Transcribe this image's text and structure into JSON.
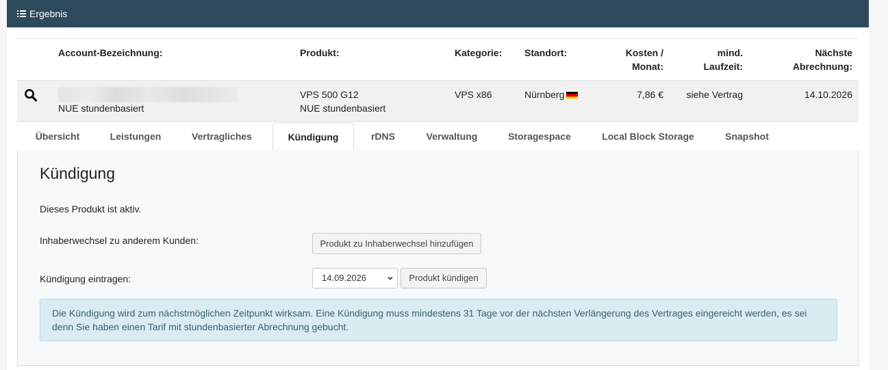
{
  "panel": {
    "title": "Ergebnis",
    "title_icon": "list-icon"
  },
  "table": {
    "headers": {
      "account": "Account-Bezeichnung:",
      "product": "Produkt:",
      "category": "Kategorie:",
      "location": "Standort:",
      "cost_line1": "Kosten /",
      "cost_line2": "Monat:",
      "term_line1": "mind.",
      "term_line2": "Laufzeit:",
      "billing_line1": "Nächste",
      "billing_line2": "Abrechnung:"
    },
    "row": {
      "account_sub": "NUE stundenbasiert",
      "product_line1": "VPS 500 G12",
      "product_line2": "NUE stundenbasiert",
      "category": "VPS x86",
      "location": "Nürnberg",
      "flag_colors": [
        "#000000",
        "#dd0000",
        "#ffce00"
      ],
      "cost": "7,86 €",
      "term": "siehe Vertrag",
      "next_billing": "14.10.2026"
    }
  },
  "tabs": [
    {
      "label": "Übersicht",
      "active": false
    },
    {
      "label": "Leistungen",
      "active": false
    },
    {
      "label": "Vertragliches",
      "active": false
    },
    {
      "label": "Kündigung",
      "active": true
    },
    {
      "label": "rDNS",
      "active": false
    },
    {
      "label": "Verwaltung",
      "active": false
    },
    {
      "label": "Storagespace",
      "active": false
    },
    {
      "label": "Local Block Storage",
      "active": false
    },
    {
      "label": "Snapshot",
      "active": false
    }
  ],
  "cancellation": {
    "heading": "Kündigung",
    "status_text": "Dieses Produkt ist aktiv.",
    "owner_change_label": "Inhaberwechsel zu anderem Kunden:",
    "owner_change_button": "Produkt zu Inhaberwechsel hinzufügen",
    "cancel_label": "Kündigung eintragen:",
    "cancel_date": "14.09.2026",
    "cancel_button": "Produkt kündigen",
    "info_text": "Die Kündigung wird zum nächstmöglichen Zeitpunkt wirksam. Eine Kündigung muss mindestens 31 Tage vor der nächsten Verlängerung des Vertrages eingereicht werden, es sei denn Sie haben einen Tarif mit stundenbasierter Abrechnung gebucht."
  },
  "colors": {
    "header_bg": "#2d4a5c",
    "info_bg": "#d9ecf1",
    "info_text": "#3b6171"
  }
}
